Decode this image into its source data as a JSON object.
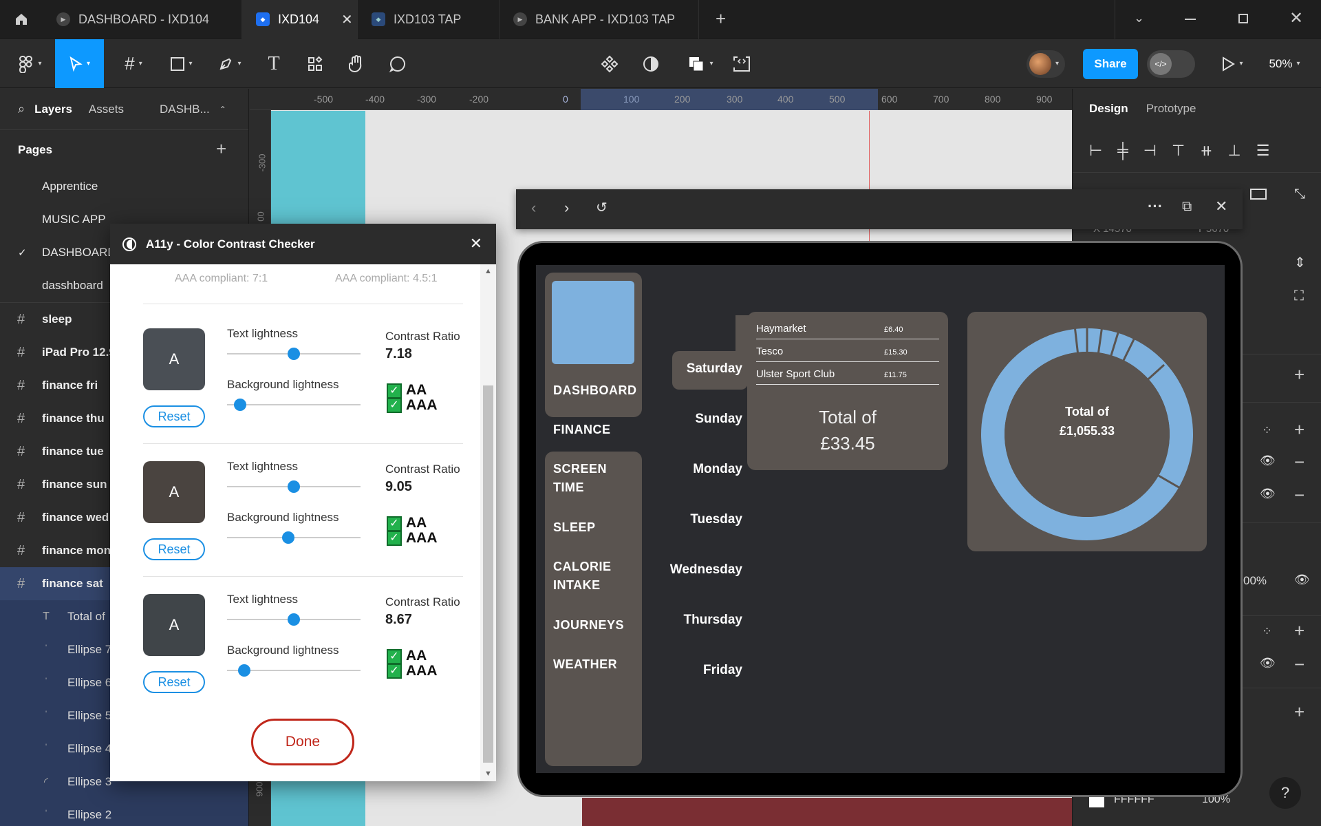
{
  "tabs": [
    {
      "label": "DASHBOARD - IXD104",
      "icon": "play-icon"
    },
    {
      "label": "IXD104",
      "icon": "figma-file-icon",
      "active": true
    },
    {
      "label": "IXD103 TAP",
      "icon": "figma-file-icon"
    },
    {
      "label": "BANK APP - IXD103 TAP",
      "icon": "play-icon"
    }
  ],
  "toolbar": {
    "share_label": "Share",
    "zoom": "50%"
  },
  "left_panel": {
    "tab_layers": "Layers",
    "tab_assets": "Assets",
    "page_selector": "DASHB...",
    "pages_title": "Pages",
    "pages": [
      "Apprentice",
      "MUSIC APP",
      "DASHBOARD",
      "dasshboard"
    ],
    "current_page": "DASHBOARD",
    "layers": [
      "sleep",
      "iPad Pro 12.9",
      "finance fri",
      "finance thu",
      "finance tue",
      "finance sun",
      "finance wed",
      "finance mon",
      "finance sat"
    ],
    "children": [
      "Total of",
      "Ellipse 7",
      "Ellipse 6",
      "Ellipse 5",
      "Ellipse 4",
      "Ellipse 3",
      "Ellipse 2"
    ]
  },
  "ruler": {
    "h_ticks": [
      "-500",
      "-400",
      "-300",
      "-200",
      "0",
      "100",
      "200",
      "300",
      "400",
      "500",
      "600",
      "700",
      "800",
      "900"
    ],
    "v_ticks": [
      "-300",
      "00",
      "900"
    ]
  },
  "right_panel": {
    "tab_design": "Design",
    "tab_prototype": "Prototype",
    "pos_x": "X 14570",
    "pos_y": "Y 5670",
    "opacity": "00%",
    "fill_hex": "FFFFFF",
    "fill_opacity": "100%",
    "help": "?"
  },
  "plugin": {
    "title": "A11y - Color Contrast Checker",
    "prev_aaa_text": "AAA compliant: 7:1",
    "prev_aaa_large": "AAA compliant: 4.5:1",
    "swatch_letter": "A",
    "text_lightness_label": "Text lightness",
    "bg_lightness_label": "Background lightness",
    "ratio_label": "Contrast Ratio",
    "reset_label": "Reset",
    "aa_label": "AA",
    "aaa_label": "AAA",
    "done_label": "Done",
    "rows": [
      {
        "ratio": "7.18",
        "swatch": "#4a4f55",
        "text_lightness": 0.5,
        "bg_lightness": 0.1
      },
      {
        "ratio": "9.05",
        "swatch": "#4a4440",
        "text_lightness": 0.5,
        "bg_lightness": 0.46
      },
      {
        "ratio": "8.67",
        "swatch": "#404549",
        "text_lightness": 0.5,
        "bg_lightness": 0.13
      }
    ]
  },
  "app": {
    "nav": [
      "DASHBOARD",
      "FINANCE",
      "SCREEN\nTIME",
      "SLEEP",
      "CALORIE\nINTAKE",
      "JOURNEYS",
      "WEATHER"
    ],
    "days": [
      "Saturday",
      "Sunday",
      "Monday",
      "Tuesday",
      "Wednesday",
      "Thursday",
      "Friday"
    ],
    "transactions": [
      {
        "name": "Haymarket",
        "amount": "£6.40"
      },
      {
        "name": "Tesco",
        "amount": "£15.30"
      },
      {
        "name": "Ulster Sport Club",
        "amount": "£11.75"
      }
    ],
    "day_total_line1": "Total of",
    "day_total_line2": "£33.45",
    "donut_total_line1": "Total of",
    "donut_total_line2": "£1,055.33"
  },
  "colors": {
    "figma_blue": "#0d99ff",
    "light_blue": "#7eb1de",
    "nav_panel": "#5a5450",
    "teal_frame": "#5fc4d1",
    "checkbox_green": "#22b14c",
    "done_red": "#c0271b"
  }
}
